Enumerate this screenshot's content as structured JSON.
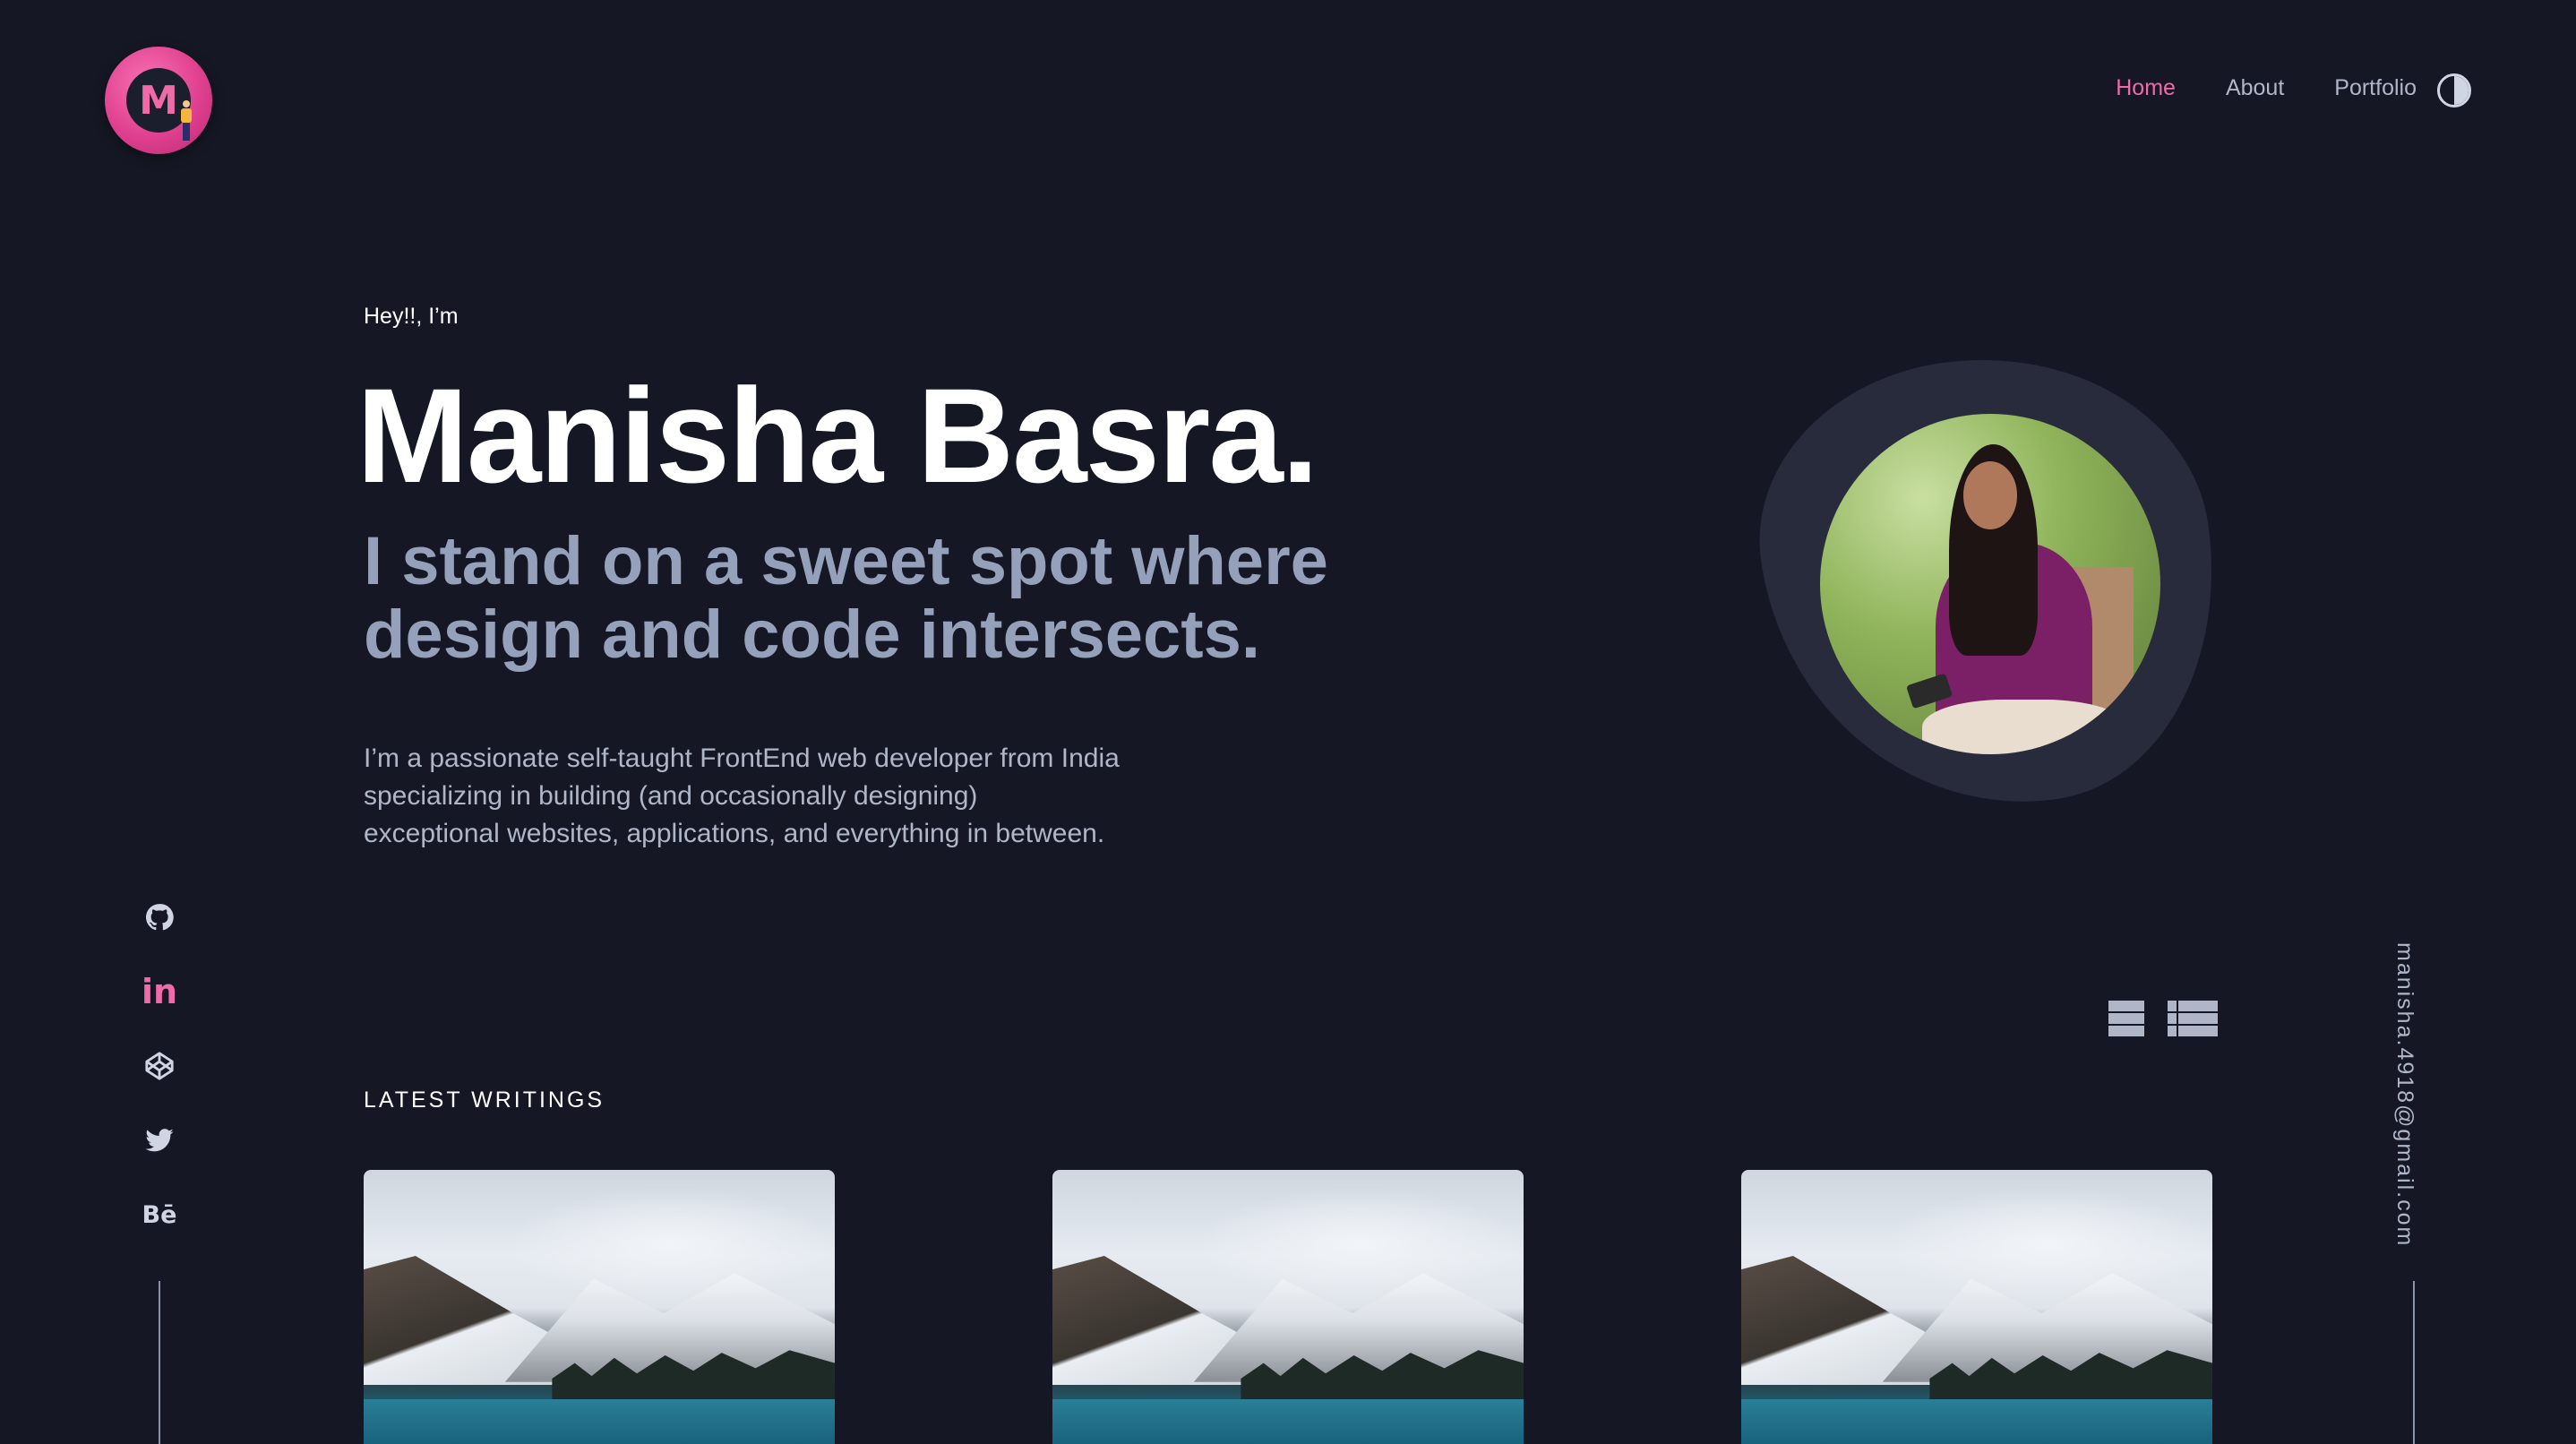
{
  "brand": {
    "logo_letter": "M"
  },
  "nav": {
    "items": [
      {
        "label": "Home",
        "active": true
      },
      {
        "label": "About",
        "active": false
      },
      {
        "label": "Portfolio",
        "active": false
      }
    ]
  },
  "hero": {
    "greeting": "Hey!!, I’m",
    "name": "Manisha Basra.",
    "tagline": "I stand on a sweet spot where design and code intersects.",
    "intro_lines": [
      "I’m a passionate self-taught FrontEnd web developer from India",
      "specializing in building (and occasionally designing)",
      "exceptional websites, applications, and everything in between."
    ]
  },
  "social": {
    "icons": [
      "github-icon",
      "linkedin-icon",
      "codepen-icon",
      "twitter-icon",
      "behance-icon"
    ],
    "linkedin_text": "in",
    "behance_text": "Bē"
  },
  "contact": {
    "email": "manisha.4918@gmail.com"
  },
  "writings": {
    "title": "LATEST WRITINGS",
    "layout_options": [
      "grid",
      "rows",
      "list"
    ],
    "active_layout": "grid"
  },
  "colors": {
    "background": "#151824",
    "accent": "#f06aaa",
    "muted_text": "#aeb6c8",
    "tagline": "#95a0bb",
    "blob": "#272b3c"
  }
}
